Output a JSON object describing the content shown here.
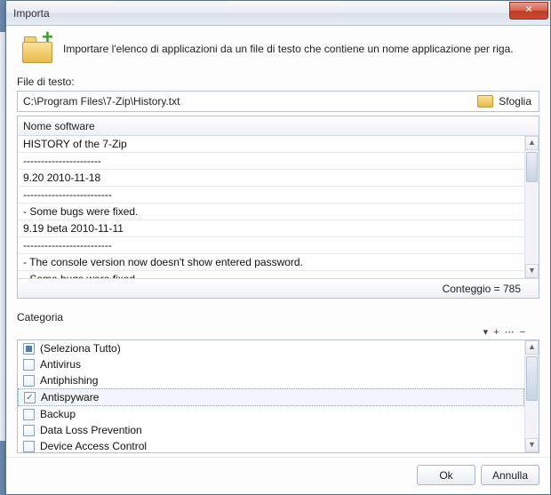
{
  "window": {
    "title": "Importa",
    "close_glyph": "✕"
  },
  "intro": "Importare l'elenco di applicazioni da un file di testo che contiene un nome applicazione per riga.",
  "file": {
    "label": "File di testo:",
    "path": "C:\\Program Files\\7-Zip\\History.txt",
    "browse": "Sfoglia"
  },
  "grid": {
    "header": "Nome software",
    "rows": [
      "HISTORY of the 7-Zip",
      "----------------------",
      "9.20        2010-11-18",
      "-------------------------",
      "- Some bugs were fixed.",
      "9.19 beta    2010-11-11",
      "-------------------------",
      "- The console version now doesn't show entered password.",
      "- Some bugs were fixed."
    ],
    "count_label": "Conteggio = 785"
  },
  "category": {
    "label": "Categoria",
    "toolbar": {
      "dropdown": "▾",
      "add": "+",
      "more": "⋯",
      "minus": "−"
    },
    "items": [
      {
        "label": "(Seleziona Tutto)",
        "state": "tri"
      },
      {
        "label": "Antivirus",
        "state": "off"
      },
      {
        "label": "Antiphishing",
        "state": "off"
      },
      {
        "label": "Antispyware",
        "state": "on",
        "selected": true
      },
      {
        "label": "Backup",
        "state": "off"
      },
      {
        "label": "Data Loss Prevention",
        "state": "off"
      },
      {
        "label": "Device Access Control",
        "state": "off"
      }
    ]
  },
  "buttons": {
    "ok": "Ok",
    "cancel": "Annulla"
  }
}
